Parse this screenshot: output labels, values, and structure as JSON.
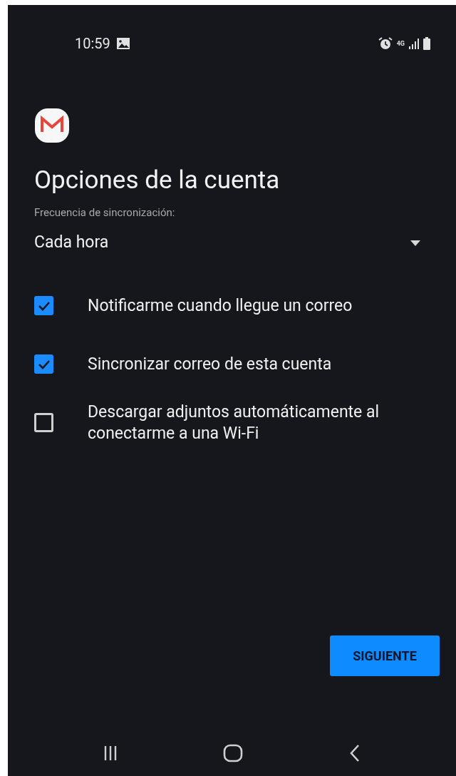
{
  "status_bar": {
    "time": "10:59",
    "network": "4G"
  },
  "title": "Opciones de la cuenta",
  "sync": {
    "label": "Frecuencia de sincronización:",
    "value": "Cada hora"
  },
  "options": [
    {
      "label": "Notificarme cuando llegue un correo",
      "checked": true
    },
    {
      "label": "Sincronizar correo de esta cuenta",
      "checked": true
    },
    {
      "label": "Descargar adjuntos automáticamente al conectarme a una Wi-Fi",
      "checked": false
    }
  ],
  "buttons": [
    "SIGUIENTE"
  ]
}
